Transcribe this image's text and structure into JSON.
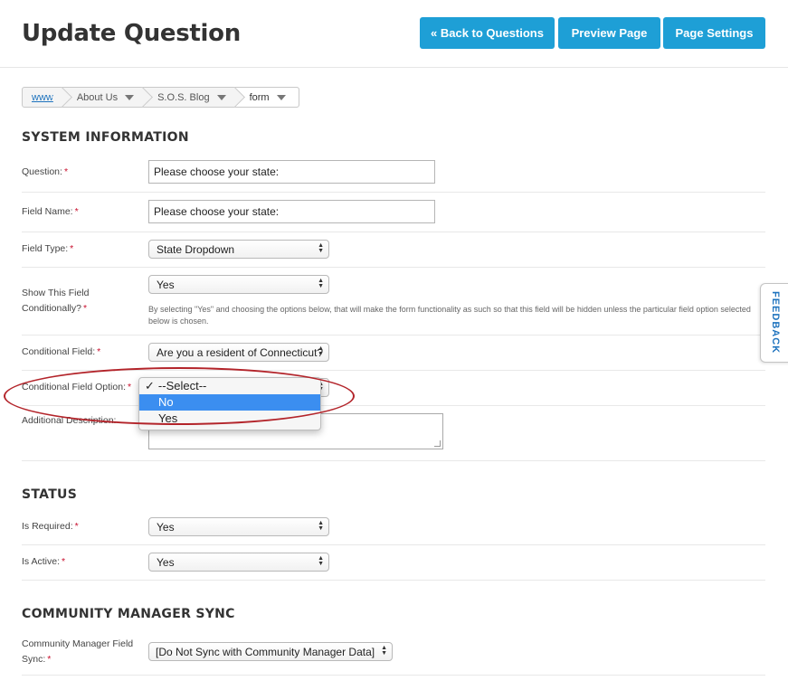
{
  "header": {
    "title": "Update Question",
    "buttons": {
      "back": "« Back to Questions",
      "preview": "Preview Page",
      "settings": "Page Settings"
    }
  },
  "breadcrumb": {
    "items": [
      "www",
      "About Us",
      "S.O.S. Blog",
      "form"
    ]
  },
  "required_mark": "*",
  "system": {
    "title": "SYSTEM INFORMATION",
    "question_label": "Question:",
    "question_value": "Please choose your state:",
    "field_name_label": "Field Name:",
    "field_name_value": "Please choose your state:",
    "field_type_label": "Field Type:",
    "field_type_value": "State Dropdown",
    "show_conditional_label": "Show This Field Conditionally?",
    "show_conditional_value": "Yes",
    "show_conditional_help": "By selecting \"Yes\" and choosing the options below, that will make the form functionality as such so that this field will be hidden unless the particular field option selected below is chosen.",
    "conditional_field_label": "Conditional Field:",
    "conditional_field_value": "Are you a resident of Connecticut?",
    "conditional_option_label": "Conditional Field Option:",
    "conditional_option_options": [
      "--Select--",
      "No",
      "Yes"
    ],
    "conditional_option_checkmark": "✓",
    "additional_desc_label": "Additional Description:"
  },
  "status": {
    "title": "STATUS",
    "is_required_label": "Is Required:",
    "is_required_value": "Yes",
    "is_active_label": "Is Active:",
    "is_active_value": "Yes"
  },
  "cm_sync": {
    "title": "COMMUNITY MANAGER SYNC",
    "field_sync_label": "Community Manager Field Sync:",
    "field_sync_value": "[Do Not Sync with Community Manager Data]"
  },
  "feedback": {
    "label": "FEEDBACK"
  },
  "colors": {
    "primary_button": "#1e9fd6",
    "dropdown_highlight": "#3b8ef0",
    "annotation_oval": "#b3242a",
    "required": "#c8102e"
  }
}
